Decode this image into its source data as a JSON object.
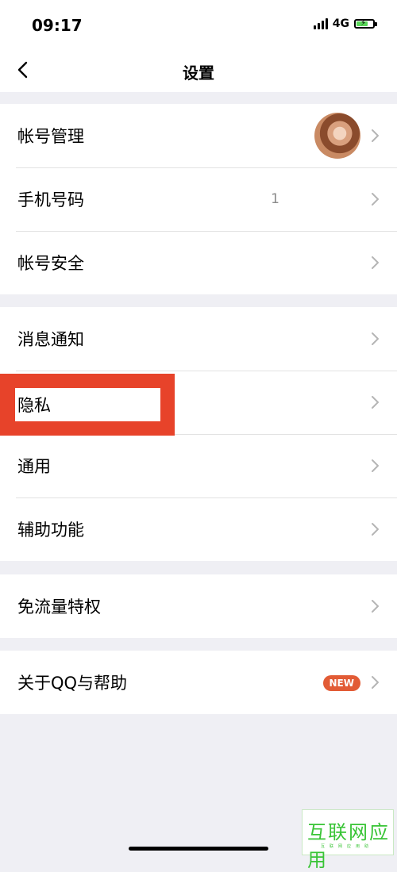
{
  "status_bar": {
    "time": "09:17",
    "network": "4G"
  },
  "nav": {
    "title": "设置"
  },
  "groups": [
    {
      "items": [
        {
          "label": "帐号管理"
        },
        {
          "label": "手机号码",
          "value": "1"
        },
        {
          "label": "帐号安全"
        }
      ]
    },
    {
      "items": [
        {
          "label": "消息通知"
        },
        {
          "label": "隐私"
        },
        {
          "label": "通用"
        },
        {
          "label": "辅助功能"
        }
      ]
    },
    {
      "items": [
        {
          "label": "免流量特权"
        }
      ]
    },
    {
      "items": [
        {
          "label": "关于QQ与帮助",
          "badge": "NEW"
        }
      ]
    }
  ],
  "colors": {
    "highlight": "#e7432a",
    "badge": "#e25b35"
  },
  "watermark": {
    "text": "互联网应用",
    "sub": "互联网应用助"
  }
}
